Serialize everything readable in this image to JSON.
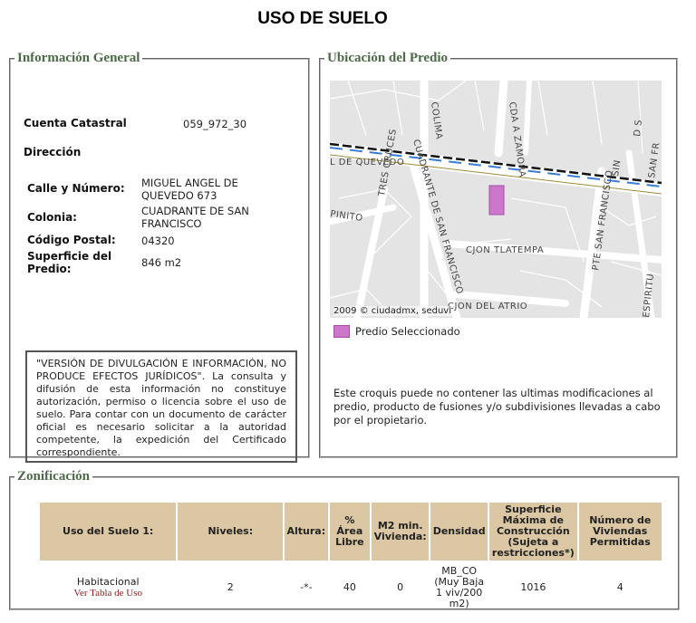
{
  "page": {
    "title": "USO DE SUELO"
  },
  "general": {
    "legend": "Información General",
    "cuenta_label": "Cuenta Catastral",
    "cuenta_value": "059_972_30",
    "direccion_label": "Dirección",
    "calle_label": "Calle y Número:",
    "calle_value_1": "MIGUEL ANGEL DE",
    "calle_value_2": "QUEVEDO 673",
    "colonia_label": "Colonia:",
    "colonia_value_1": "CUADRANTE DE SAN",
    "colonia_value_2": "FRANCISCO",
    "cp_label": "Código Postal:",
    "cp_value": "04320",
    "superficie_label_1": "Superficie del",
    "superficie_label_2": "Predio:",
    "superficie_value": "846 m2",
    "disclaimer": "\"VERSIÓN DE DIVULGACIÓN E INFORMACIÓN, NO PRODUCE EFECTOS JURÍDICOS\". La consulta y difusión de esta información no constituye autorización, permiso o licencia sobre el uso de suelo. Para contar con un documento de carácter oficial es necesario solicitar a la autoridad competente, la expedición del Certificado correspondiente."
  },
  "ubicacion": {
    "legend": "Ubicación del Predio",
    "map_credit": "2009 © ciudadmx, seduvi",
    "streets": {
      "colima": "COLIMA",
      "zamora": "CDA A ZAMORA",
      "quevedo": "L DE QUEVEDO",
      "cuadrante": "CUADRANTE DE SAN FRANCISCO",
      "tres_cruces": "TRES CRUCES",
      "pinito": "PINITO",
      "tlatempa": "CJON TLATEMPA",
      "atrio": "CJON DEL ATRIO",
      "pte_san_francisco": "PTE SAN FRANCISCO",
      "sin": "SIN",
      "san_fran": "SAN FR",
      "espiritu": "ESPIRITU",
      "d_s": "D S"
    },
    "legend_label": "Predio Seleccionado",
    "note": "Este croquis puede no contener las ultimas modificaciones al predio, producto de fusiones y/o subdivisiones llevadas a cabo por el propietario."
  },
  "zonificacion": {
    "legend": "Zonificación",
    "headers": {
      "uso": "Uso del Suelo 1:",
      "niveles": "Niveles:",
      "altura": "Altura:",
      "area_libre": "% Área Libre",
      "m2_min": "M2 min. Vivienda:",
      "densidad": "Densidad",
      "superficie_max": "Superficie Máxima de Construcción (Sujeta a restricciones*)",
      "viviendas": "Número de Viviendas Permitidas"
    },
    "row": {
      "uso": "Habitacional",
      "ver_tabla": "Ver Tabla de Uso",
      "niveles": "2",
      "altura": "-*-",
      "area_libre": "40",
      "m2_min": "0",
      "densidad": "MB_CO (Muy Baja 1 viv/200 m2)",
      "superficie_max": "1016",
      "viviendas": "4"
    }
  },
  "colors": {
    "legend_text": "#4b6b46",
    "header_bg": "#dbc7a3",
    "predio": "#cc77cc",
    "link": "#8b1c1c"
  }
}
